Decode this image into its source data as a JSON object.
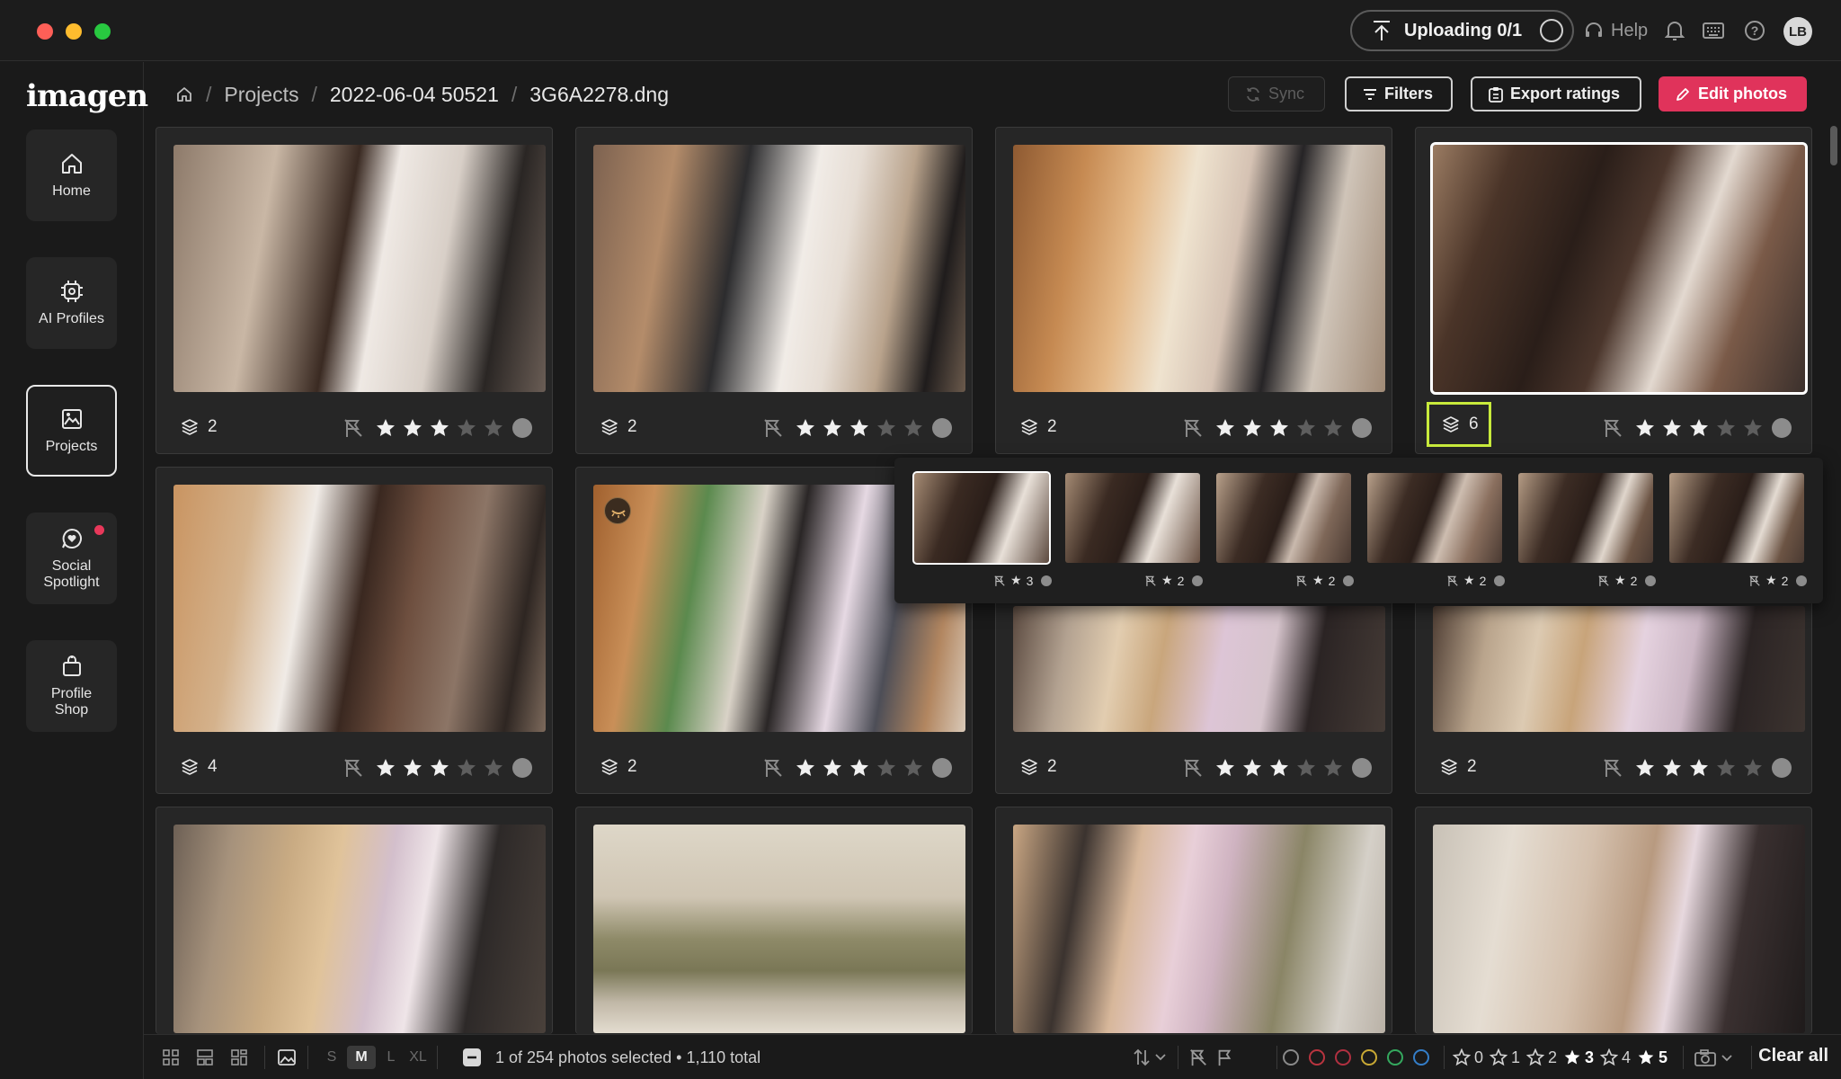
{
  "titlebar": {
    "upload_label": "Uploading 0/1",
    "help_label": "Help",
    "avatar_initials": "LB"
  },
  "sidebar": {
    "logo": "imagen",
    "items": [
      {
        "label": "Home",
        "icon": "home-icon"
      },
      {
        "label": "AI Profiles",
        "icon": "ai-chip-icon"
      },
      {
        "label": "Projects",
        "icon": "projects-icon",
        "active": true
      },
      {
        "label": "Social Spotlight",
        "icon": "spotlight-icon",
        "notification": true
      },
      {
        "label": "Profile Shop",
        "icon": "shop-icon"
      }
    ]
  },
  "breadcrumb": {
    "root": "Projects",
    "project": "2022-06-04 50521",
    "file": "3G6A2278.dng"
  },
  "header": {
    "sync_label": "Sync",
    "filters_label": "Filters",
    "export_label": "Export ratings",
    "edit_label": "Edit photos"
  },
  "photos": [
    {
      "stack": "2",
      "rating": 3
    },
    {
      "stack": "2",
      "rating": 3
    },
    {
      "stack": "2",
      "rating": 3
    },
    {
      "stack": "6",
      "rating": 3,
      "selected": true
    },
    {
      "stack": "4",
      "rating": 3
    },
    {
      "stack": "2",
      "rating": 3
    },
    {
      "stack": "2",
      "rating": 3
    },
    {
      "stack": "2",
      "rating": 3
    }
  ],
  "stack_popover": [
    {
      "rating": "3"
    },
    {
      "rating": "2"
    },
    {
      "rating": "2"
    },
    {
      "rating": "2"
    },
    {
      "rating": "2"
    },
    {
      "rating": "2"
    }
  ],
  "footer": {
    "sizes": [
      "S",
      "M",
      "L",
      "XL"
    ],
    "active_size": "M",
    "selection_text": "1 of 254 photos selected • 1,110 total",
    "color_labels": [
      "#8a8a8a",
      "#d0404c",
      "#c8384a",
      "#d8b63c",
      "#3cb86a",
      "#3c8ad8"
    ],
    "star_filters": [
      "0",
      "1",
      "2",
      "3",
      "4",
      "5"
    ],
    "clear_label": "Clear all"
  },
  "colors": {
    "accent": "#e0335b",
    "highlight": "#c8ea3c"
  }
}
